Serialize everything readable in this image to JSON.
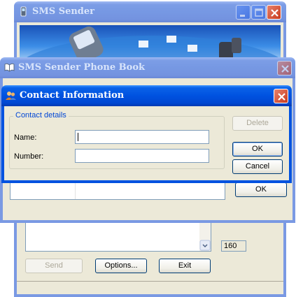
{
  "main_window": {
    "title": "SMS Sender",
    "send_label": "Send",
    "options_label": "Options...",
    "exit_label": "Exit",
    "char_count": "160"
  },
  "phonebook_window": {
    "title": "SMS Sender Phone Book",
    "ok_label": "OK"
  },
  "contact_dialog": {
    "title": "Contact Information",
    "group_label": "Contact details",
    "name_label": "Name:",
    "number_label": "Number:",
    "name_value": "",
    "number_value": "",
    "delete_label": "Delete",
    "ok_label": "OK",
    "cancel_label": "Cancel"
  },
  "icons": {
    "main_window": "sms-phone-icon",
    "phonebook": "book-icon",
    "contact": "contacts-icon"
  },
  "colors": {
    "titlebar_active": "#0052e0",
    "titlebar_inactive": "#7a99e3",
    "close_button": "#c83a1d",
    "dialog_face": "#ece9d8",
    "group_label": "#0046d5"
  }
}
